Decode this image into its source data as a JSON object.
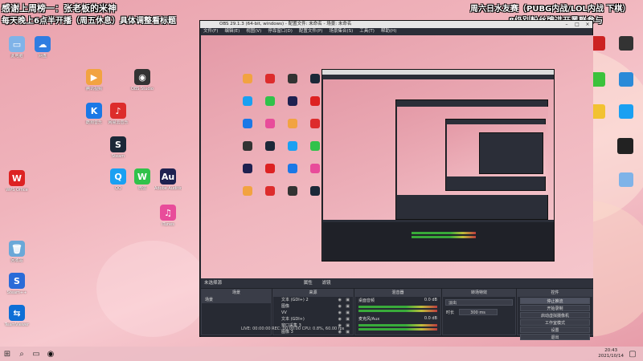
{
  "overlay": {
    "top_left_line1": "感谢上周榜一：张老板的米神",
    "top_left_line2": "每天晚上6点半开播（周五休息）具体调整看标题",
    "top_right_line1": "周六日水友赛（PUBG内战/LOL内战 下棋）",
    "top_right_line2": "8级别粉丝牌进开黑群参与"
  },
  "obs": {
    "title": "OBS 29.1.3 (64-bit, windows) - 配置文件: 未命名 - 场景: 未命名",
    "menu": [
      "文件(F)",
      "编辑(E)",
      "视图(V)",
      "停靠窗口(D)",
      "配置文件(P)",
      "场景集合(S)",
      "工具(T)",
      "帮助(H)"
    ],
    "no_source": "未选择源",
    "props_label": "属性",
    "filters_label": "滤镜",
    "docks": {
      "scenes": {
        "title": "场景",
        "items": [
          "场景"
        ]
      },
      "sources": {
        "title": "来源",
        "items": [
          "文本 (GDI+) 2",
          "图像",
          "VV",
          "文本 (GDI+)",
          "窗口采集 3",
          "图像 3"
        ]
      },
      "mixer": {
        "title": "混音器",
        "channels": [
          "桌面音频",
          "麦克风/Aux"
        ],
        "levels": [
          "0.0 dB",
          "0.0 dB"
        ]
      },
      "transitions": {
        "title": "转场特效",
        "type": "淡出",
        "duration_label": "时长",
        "duration": "300 ms"
      },
      "controls": {
        "title": "控件",
        "buttons": [
          "停止推流",
          "开始录制",
          "启动虚拟摄像机",
          "工作室模式",
          "设置",
          "退出"
        ]
      }
    },
    "status": "LIVE: 00:00:00   REC: 00:00:00   CPU: 0.8%, 60.00 fps"
  },
  "desktop_icons": [
    {
      "label": "此电脑",
      "color": "#7fb3e8",
      "glyph": "▭"
    },
    {
      "label": "网盘",
      "color": "#2f7de1",
      "glyph": "☁"
    },
    {
      "label": "腾讯视频",
      "color": "#f2a341",
      "glyph": "▶"
    },
    {
      "label": "网易云音乐",
      "color": "#dd2c2c",
      "glyph": "♪"
    },
    {
      "label": "OBS Studio",
      "color": "#333",
      "glyph": "◉"
    },
    {
      "label": "Steam",
      "color": "#1b2838",
      "glyph": "S"
    },
    {
      "label": "QQ",
      "color": "#1aa0f2",
      "glyph": "Q"
    },
    {
      "label": "微信",
      "color": "#30c24a",
      "glyph": "W"
    },
    {
      "label": "Adobe Audition",
      "color": "#1e2150",
      "glyph": "Au"
    },
    {
      "label": "WPS Office",
      "color": "#d22",
      "glyph": "W"
    },
    {
      "label": "酷狗音乐",
      "color": "#1b78e6",
      "glyph": "K"
    },
    {
      "label": "iTunes",
      "color": "#e84c9a",
      "glyph": "♫"
    },
    {
      "label": "回收站",
      "color": "#6aa8d8",
      "glyph": "🗑"
    },
    {
      "label": "Steam++",
      "color": "#2a6bd8",
      "glyph": "S"
    },
    {
      "label": "TeamViewer",
      "color": "#0e6fd6",
      "glyph": "⇆"
    }
  ],
  "taskbar": {
    "time": "20:43",
    "date": "2021/10/14"
  }
}
